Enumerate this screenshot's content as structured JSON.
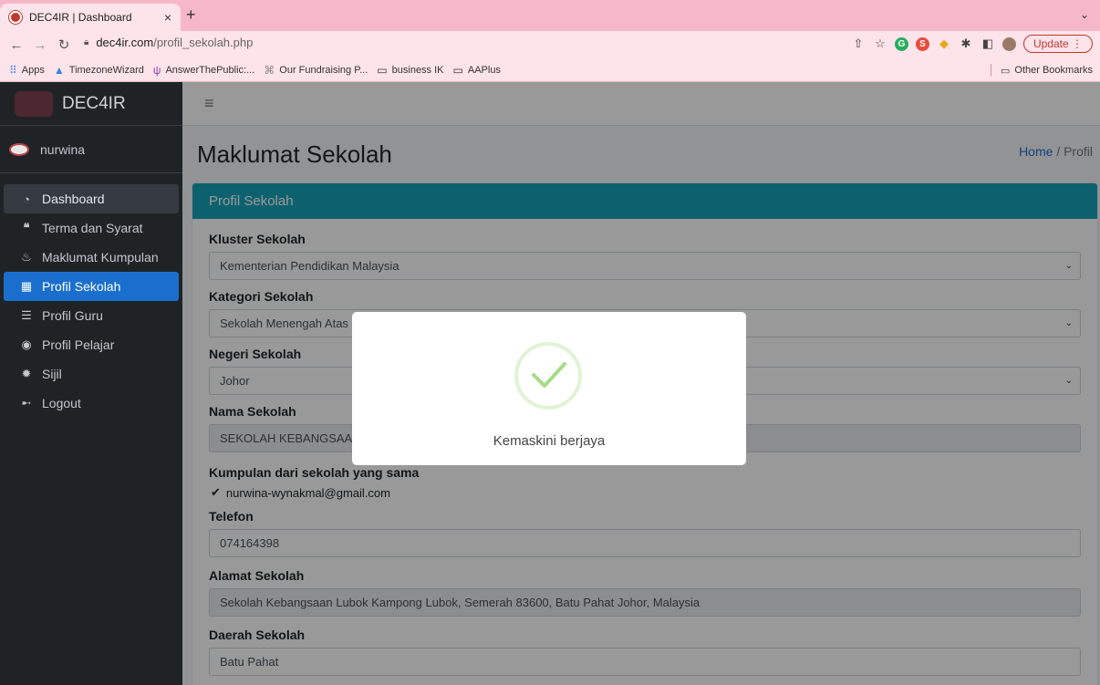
{
  "browser": {
    "tab_title": "DEC4IR | Dashboard",
    "tab_close": "×",
    "new_tab": "+",
    "tab_menu": "⌄",
    "url_domain": "dec4ir.com",
    "url_path": "/profil_sekolah.php",
    "update_label": "Update",
    "bookmarks": [
      {
        "label": "Apps",
        "icon": "apps-grid-icon"
      },
      {
        "label": "TimezoneWizard",
        "icon": "timezone-icon"
      },
      {
        "label": "AnswerThePublic:...",
        "icon": "answerthepublic-icon"
      },
      {
        "label": "Our Fundraising P...",
        "icon": "fundraising-icon"
      },
      {
        "label": "business IK",
        "icon": "folder-icon"
      },
      {
        "label": "AAPlus",
        "icon": "folder-icon"
      }
    ],
    "other_bookmarks": "Other Bookmarks"
  },
  "sidebar": {
    "brand": "DEC4IR",
    "user": "nurwina",
    "items": [
      {
        "label": "Dashboard",
        "icon": "tachometer-icon"
      },
      {
        "label": "Terma dan Syarat",
        "icon": "quote-icon"
      },
      {
        "label": "Maklumat Kumpulan",
        "icon": "fire-icon"
      },
      {
        "label": "Profil Sekolah",
        "icon": "building-icon"
      },
      {
        "label": "Profil Guru",
        "icon": "cards-icon"
      },
      {
        "label": "Profil Pelajar",
        "icon": "user-circle-icon"
      },
      {
        "label": "Sijil",
        "icon": "badge-icon"
      },
      {
        "label": "Logout",
        "icon": "logout-icon"
      }
    ]
  },
  "header": {
    "menu_icon": "≡",
    "page_title": "Maklumat Sekolah",
    "breadcrumb_home": "Home",
    "breadcrumb_sep": "/",
    "breadcrumb_current": "Profil"
  },
  "card": {
    "title": "Profil Sekolah",
    "kluster_label": "Kluster Sekolah",
    "kluster_value": "Kementerian Pendidikan Malaysia",
    "kategori_label": "Kategori Sekolah",
    "kategori_value": "Sekolah Menengah Atas",
    "negeri_label": "Negeri Sekolah",
    "negeri_value": "Johor",
    "nama_label": "Nama Sekolah",
    "nama_value": "SEKOLAH KEBANGSAAN",
    "kumpulan_label": "Kumpulan dari sekolah yang sama",
    "kumpulan_value": "nurwina-wynakmal@gmail.com",
    "telefon_label": "Telefon",
    "telefon_value": "074164398",
    "alamat_label": "Alamat Sekolah",
    "alamat_value": "Sekolah Kebangsaan Lubok Kampong Lubok, Semerah 83600, Batu Pahat Johor, Malaysia",
    "daerah_label": "Daerah Sekolah",
    "daerah_value": "Batu Pahat"
  },
  "modal": {
    "message": "Kemaskini berjaya"
  },
  "colors": {
    "accent": "#17a2b8",
    "active": "#1a6fce",
    "sidebar": "#1f2325",
    "success": "#a5dc86"
  }
}
